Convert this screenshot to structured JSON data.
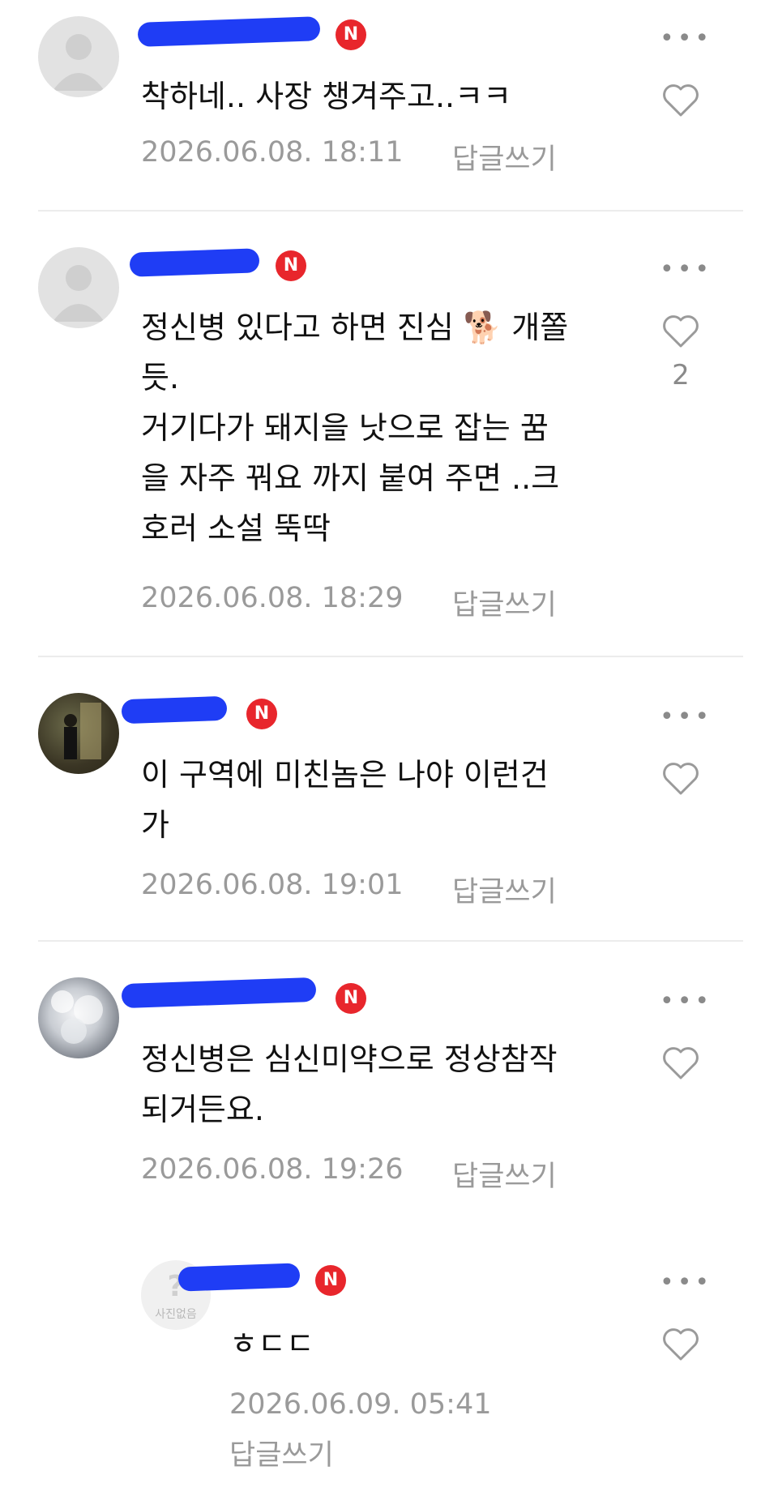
{
  "comments": [
    {
      "body": "착하네.. 사장 챙겨주고..ㅋㅋ",
      "date": "2026.06.08. 18:11",
      "reply": "답글쓰기",
      "likes": ""
    },
    {
      "body": "정신병 있다고 하면 진심 🐕 개쫄\n듯.\n거기다가 돼지을 낫으로 잡는 꿈\n을 자주 꿔요 까지 붙여 주면 ..크\n호러 소설 뚝딱",
      "date": "2026.06.08. 18:29",
      "reply": "답글쓰기",
      "likes": "2"
    },
    {
      "body": "이 구역에 미친놈은 나야 이런건\n가",
      "date": "2026.06.08. 19:01",
      "reply": "답글쓰기",
      "likes": ""
    },
    {
      "body": "정신병은 심신미약으로 정상참작\n되거든요.",
      "date": "2026.06.08. 19:26",
      "reply": "답글쓰기",
      "likes": ""
    },
    {
      "body": "ㅎㄷㄷ",
      "date": "2026.06.09. 05:41",
      "reply": "답글쓰기",
      "likes": "",
      "avatar_text": "사진없음"
    }
  ],
  "badge": "N",
  "colors": {
    "badge": "#e8262c",
    "scribble": "#1f3df5",
    "meta": "#9a9a9a",
    "divider": "#ececec"
  }
}
